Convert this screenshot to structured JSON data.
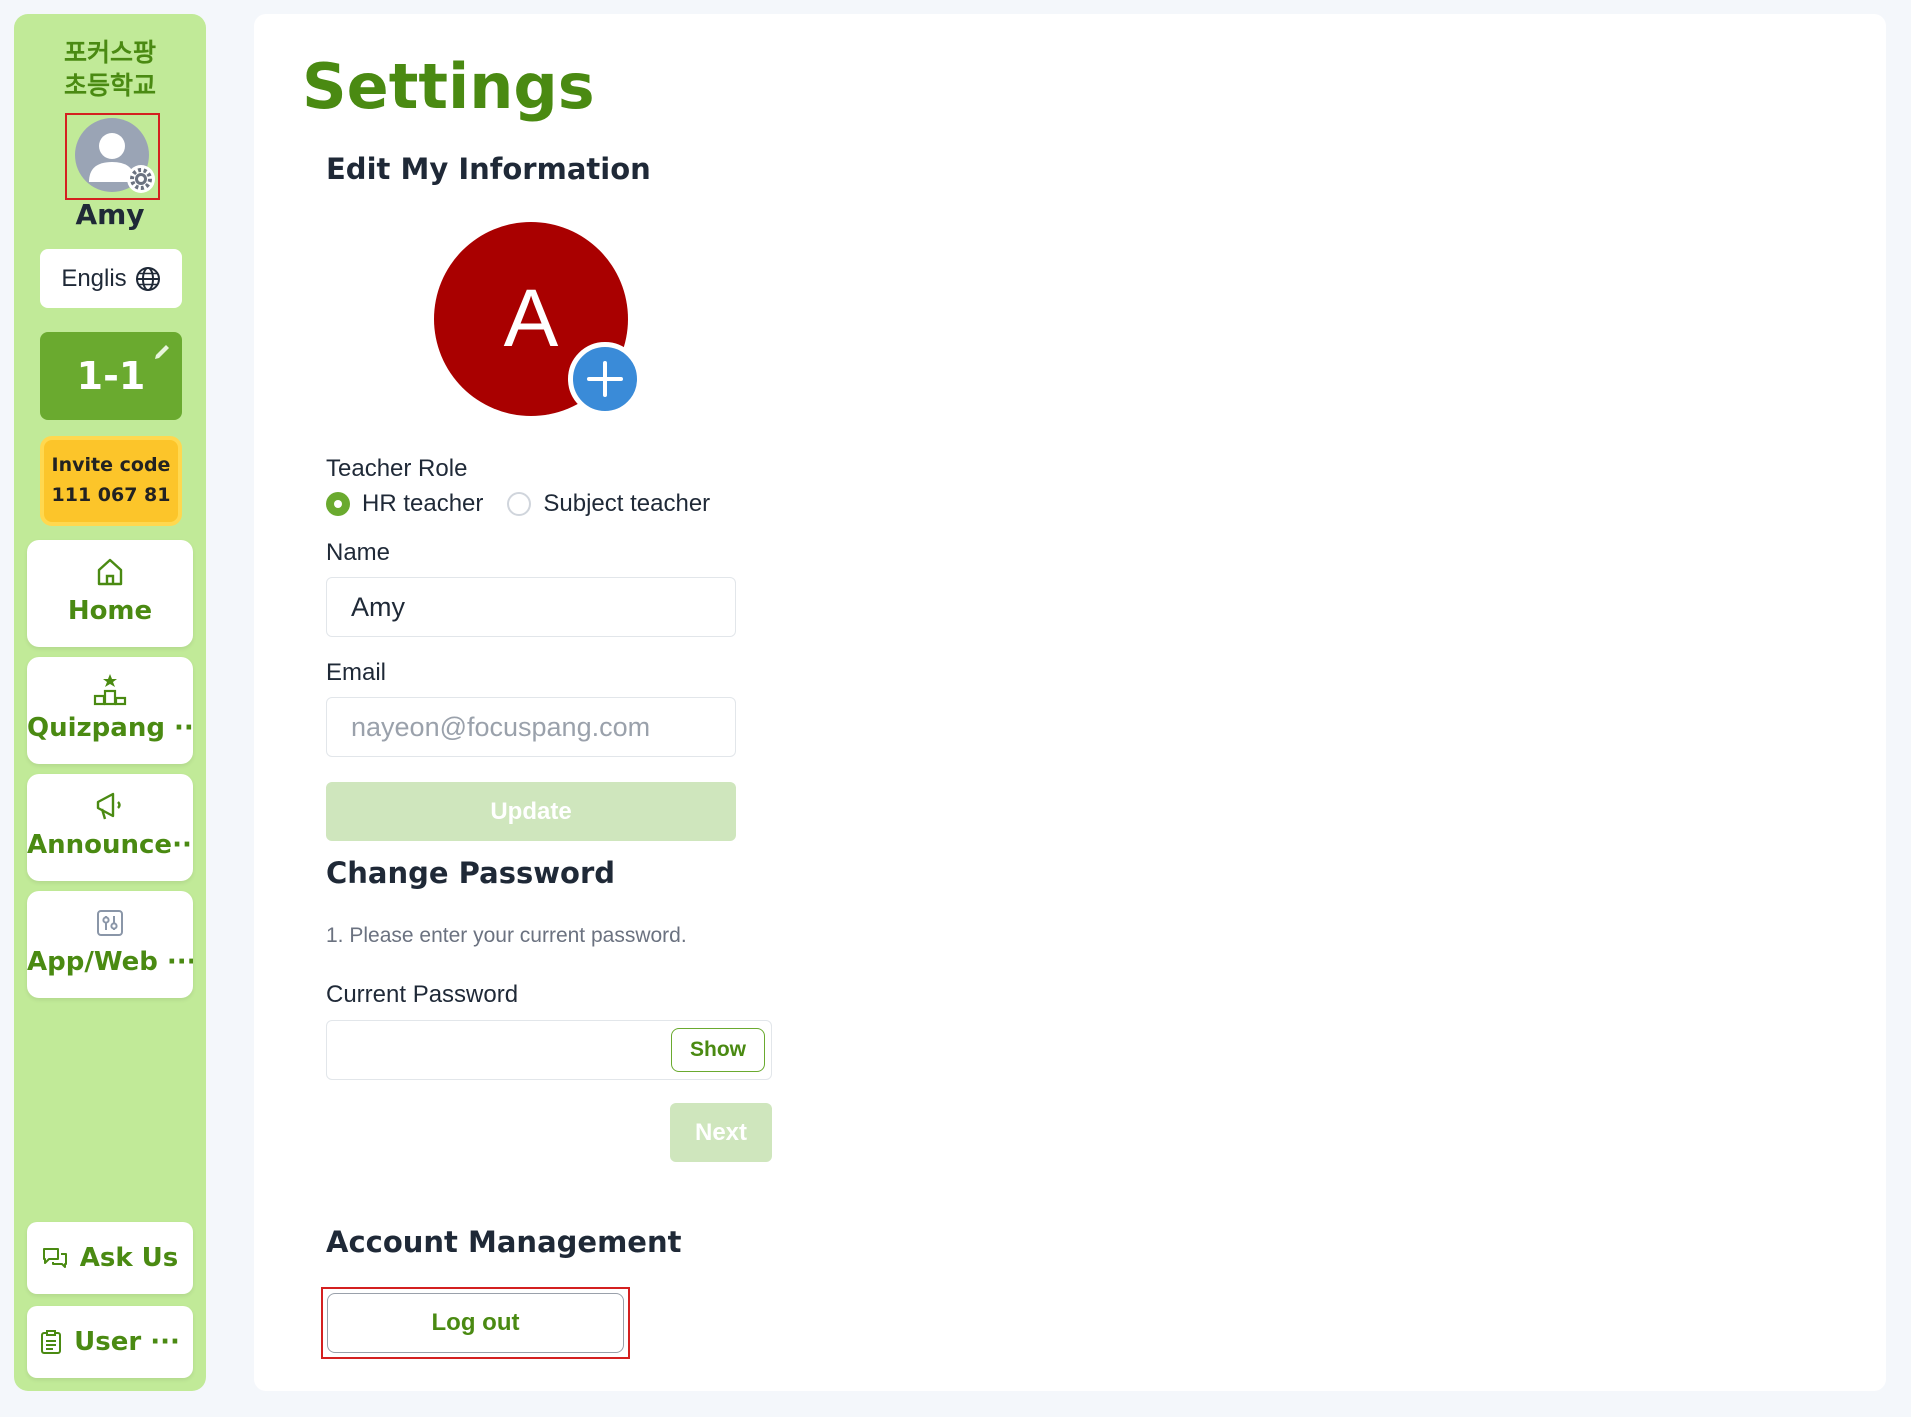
{
  "sidebar": {
    "school_line1": "포커스팡",
    "school_line2": "초등학교",
    "username": "Amy",
    "language": "Englis",
    "class_name": "1-1",
    "invite_label": "Invite code",
    "invite_code": "111 067 81",
    "nav": [
      {
        "label": "Home",
        "icon": "home-icon"
      },
      {
        "label": "Quizpang ···",
        "icon": "podium-icon"
      },
      {
        "label": "Announce···",
        "icon": "megaphone-icon"
      },
      {
        "label": "App/Web ···",
        "icon": "sliders-icon"
      }
    ],
    "bottom": [
      {
        "label": "Ask Us",
        "icon": "chat-icon"
      },
      {
        "label": "User ···",
        "icon": "clipboard-icon"
      }
    ]
  },
  "page": {
    "title": "Settings",
    "edit_title": "Edit My Information",
    "avatar_letter": "A",
    "teacher_role_label": "Teacher Role",
    "roles": [
      {
        "label": "HR teacher",
        "selected": true
      },
      {
        "label": "Subject teacher",
        "selected": false
      }
    ],
    "name_label": "Name",
    "name_value": "Amy",
    "email_label": "Email",
    "email_value": "nayeon@focuspang.com",
    "update_label": "Update",
    "password_title": "Change Password",
    "password_hint": "1. Please enter your current password.",
    "current_password_label": "Current Password",
    "show_label": "Show",
    "next_label": "Next",
    "account_title": "Account Management",
    "logout_label": "Log out"
  },
  "colors": {
    "sidebar_bg": "#c1ea98",
    "brand_green": "#4a8a12",
    "avatar_red": "#a90000",
    "invite_yellow": "#fcc52a",
    "add_blue": "#3a8bd8"
  }
}
